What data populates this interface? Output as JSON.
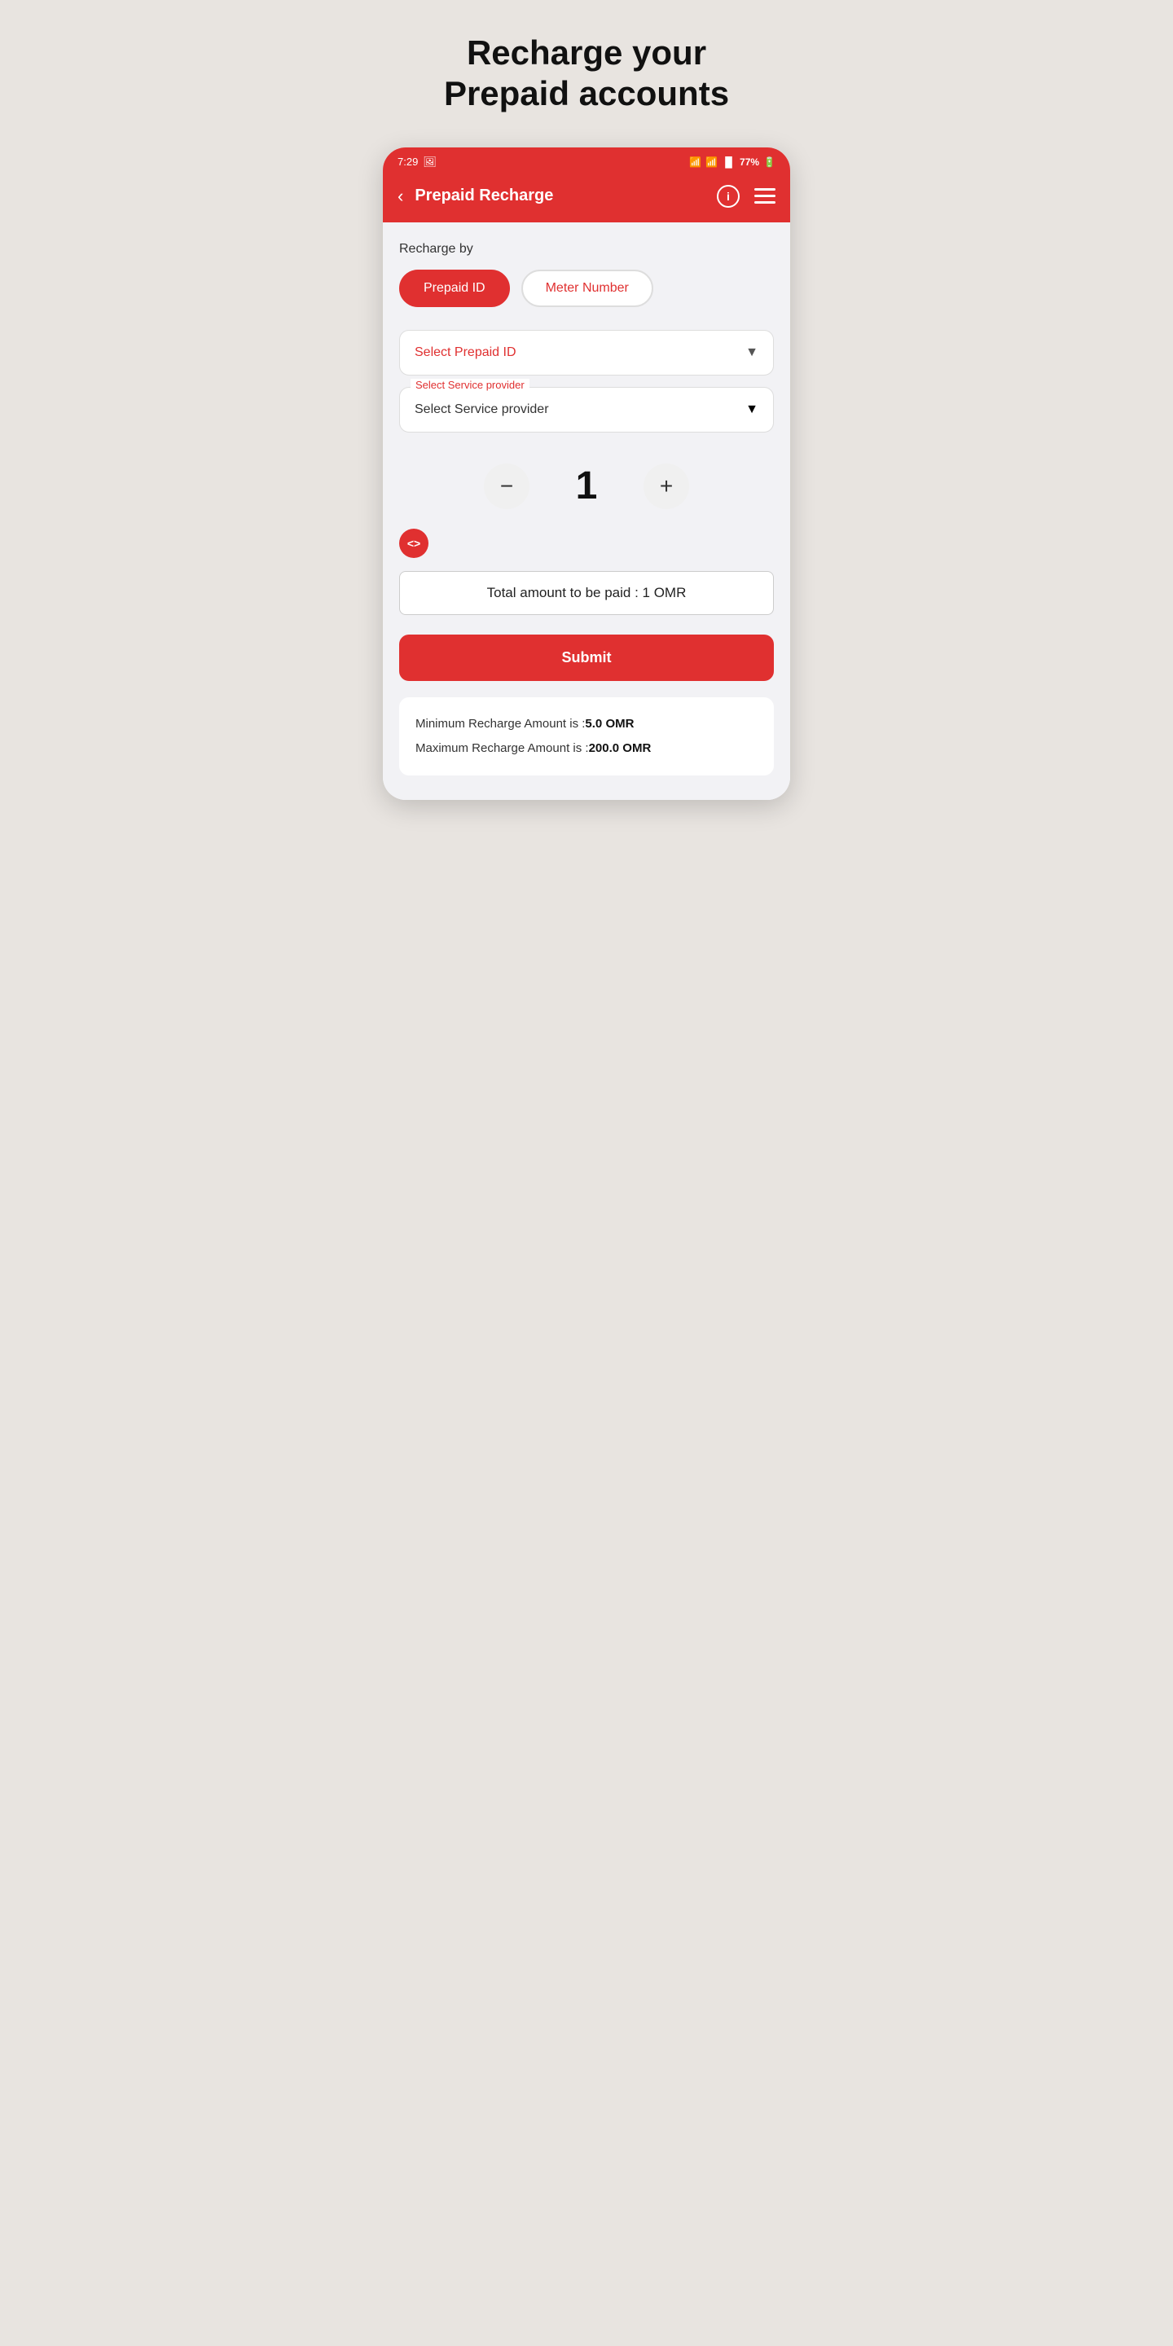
{
  "page": {
    "title_line1": "Recharge your",
    "title_line2": "Prepaid accounts"
  },
  "status_bar": {
    "time": "7:29",
    "battery": "77%"
  },
  "app_bar": {
    "title": "Prepaid Recharge",
    "info_icon": "i",
    "back_icon": "‹"
  },
  "content": {
    "recharge_by_label": "Recharge by",
    "toggle_prepaid_id": "Prepaid ID",
    "toggle_meter_number": "Meter Number",
    "select_prepaid_id_placeholder": "Select Prepaid ID",
    "select_service_provider_label": "Select Service provider",
    "select_service_provider_placeholder": "Select Service provider",
    "counter_value": "1",
    "minus_label": "−",
    "plus_label": "+",
    "code_icon_label": "<>",
    "total_amount_label": "Total amount to be paid :  1 OMR",
    "submit_label": "Submit",
    "min_recharge_label": "Minimum Recharge Amount is :",
    "min_recharge_value": "5.0 OMR",
    "max_recharge_label": "Maximum Recharge Amount is :",
    "max_recharge_value": "200.0 OMR"
  },
  "colors": {
    "primary": "#e03030",
    "background": "#e8e4e0",
    "white": "#ffffff"
  }
}
